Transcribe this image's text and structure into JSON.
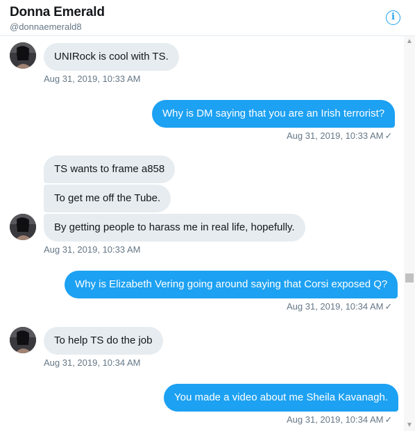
{
  "header": {
    "name": "Donna Emerald",
    "handle": "@donnaemerald8",
    "info_icon": "i"
  },
  "messages": [
    {
      "dir": "in",
      "text": "UNIRock is cool with TS.",
      "time": "Aug 31, 2019, 10:33 AM"
    },
    {
      "dir": "out",
      "text": "Why is DM saying that you are an Irish terrorist?",
      "time": "Aug 31, 2019, 10:33 AM"
    },
    {
      "dir": "in",
      "text": "TS wants to frame a858"
    },
    {
      "dir": "in",
      "text": "To get me off the Tube."
    },
    {
      "dir": "in",
      "text": "By getting people to harass me in real life, hopefully.",
      "time": "Aug 31, 2019, 10:33 AM"
    },
    {
      "dir": "out",
      "text": "Why is Elizabeth Vering going around saying that Corsi exposed Q?",
      "time": "Aug 31, 2019, 10:34 AM"
    },
    {
      "dir": "in",
      "text": "To help TS do the job",
      "time": "Aug 31, 2019, 10:34 AM"
    },
    {
      "dir": "out",
      "text": "You made a video about me Sheila Kavanagh.",
      "time": "Aug 31, 2019, 10:34 AM"
    }
  ],
  "read_receipt_icon": "✓",
  "scrollbar": {
    "up_arrow": "▲",
    "down_arrow": "▼"
  }
}
